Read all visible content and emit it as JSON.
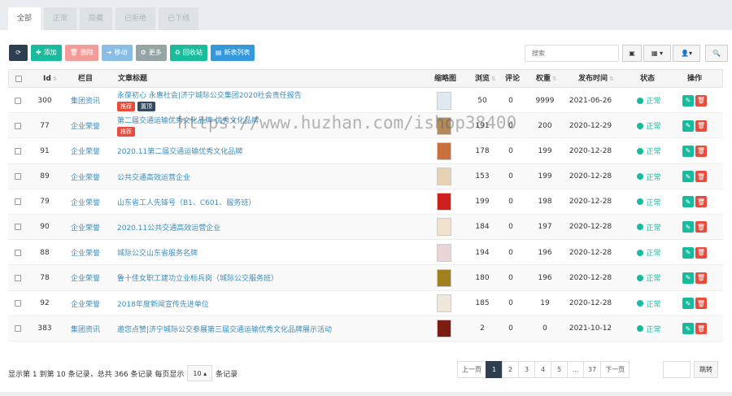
{
  "tabs": [
    {
      "label": "全部"
    },
    {
      "label": "正常"
    },
    {
      "label": "隐藏"
    },
    {
      "label": "已拒绝"
    },
    {
      "label": "已下线"
    }
  ],
  "toolbar": {
    "add": "添加",
    "delete": "删除",
    "move": "移动",
    "more": "更多",
    "recycle": "回收站",
    "news_list": "新表列表"
  },
  "search": {
    "placeholder": "搜索"
  },
  "columns": {
    "id": "Id",
    "column": "栏目",
    "title": "文章标题",
    "thumb": "缩略图",
    "views": "浏览",
    "comments": "评论",
    "weight": "权重",
    "publish_time": "发布时间",
    "status": "状态",
    "actions": "操作"
  },
  "rows": [
    {
      "id": "300",
      "column": "集团资讯",
      "title": "永葆初心 永惠社会|济宁城际公交集团2020社会责任报告",
      "badges": [
        "推荐",
        "置顶"
      ],
      "views": "50",
      "comments": "0",
      "weight": "9999",
      "date": "2021-06-26",
      "status": "正常",
      "thumb_color": "#dfe9f3"
    },
    {
      "id": "77",
      "column": "企业荣誉",
      "title": "第二届交通运输优秀文化品牌-优秀文化品牌",
      "badges": [
        "推荐"
      ],
      "views": "191",
      "comments": "0",
      "weight": "200",
      "date": "2020-12-29",
      "status": "正常",
      "thumb_color": "#b38a5a"
    },
    {
      "id": "91",
      "column": "企业荣誉",
      "title": "2020.11第二届交通运输优秀文化品牌",
      "badges": [],
      "views": "178",
      "comments": "0",
      "weight": "199",
      "date": "2020-12-28",
      "status": "正常",
      "thumb_color": "#c9703c"
    },
    {
      "id": "89",
      "column": "企业荣誉",
      "title": "公共交通高效运营企业",
      "badges": [],
      "views": "153",
      "comments": "0",
      "weight": "199",
      "date": "2020-12-28",
      "status": "正常",
      "thumb_color": "#e8d2b5"
    },
    {
      "id": "79",
      "column": "企业荣誉",
      "title": "山东省工人先锋号（B1、C601、服务班）",
      "badges": [],
      "views": "199",
      "comments": "0",
      "weight": "198",
      "date": "2020-12-28",
      "status": "正常",
      "thumb_color": "#d0201a"
    },
    {
      "id": "90",
      "column": "企业荣誉",
      "title": "2020.11公共交通高效运营企业",
      "badges": [],
      "views": "184",
      "comments": "0",
      "weight": "197",
      "date": "2020-12-28",
      "status": "正常",
      "thumb_color": "#f0e2cf"
    },
    {
      "id": "88",
      "column": "企业荣誉",
      "title": "城际公交山东省服务名牌",
      "badges": [],
      "views": "194",
      "comments": "0",
      "weight": "196",
      "date": "2020-12-28",
      "status": "正常",
      "thumb_color": "#ead4d8"
    },
    {
      "id": "78",
      "column": "企业荣誉",
      "title": "鲁十佳女职工建功立业标兵岗（城际公交服务班）",
      "badges": [],
      "views": "180",
      "comments": "0",
      "weight": "196",
      "date": "2020-12-28",
      "status": "正常",
      "thumb_color": "#a0801f"
    },
    {
      "id": "92",
      "column": "企业荣誉",
      "title": "2018年度新闻宣传先进单位",
      "badges": [],
      "views": "185",
      "comments": "0",
      "weight": "19",
      "date": "2020-12-28",
      "status": "正常",
      "thumb_color": "#efe7dc"
    },
    {
      "id": "383",
      "column": "集团资讯",
      "title": "邀您点赞|济宁城际公交参展第三届交通运输优秀文化品牌展示活动",
      "badges": [],
      "views": "2",
      "comments": "0",
      "weight": "0",
      "date": "2021-10-12",
      "status": "正常",
      "thumb_color": "#7a1d12"
    }
  ],
  "footer": {
    "summary_before": "显示第 1 到第 10 条记录，总共 366 条记录 每页显示",
    "page_size": "10",
    "summary_after": "条记录"
  },
  "pager": {
    "prev": "上一页",
    "pages": [
      "1",
      "2",
      "3",
      "4",
      "5",
      "...",
      "37"
    ],
    "next": "下一页",
    "jump": "跳转"
  },
  "watermark": "https://www.huzhan.com/ishop38400"
}
